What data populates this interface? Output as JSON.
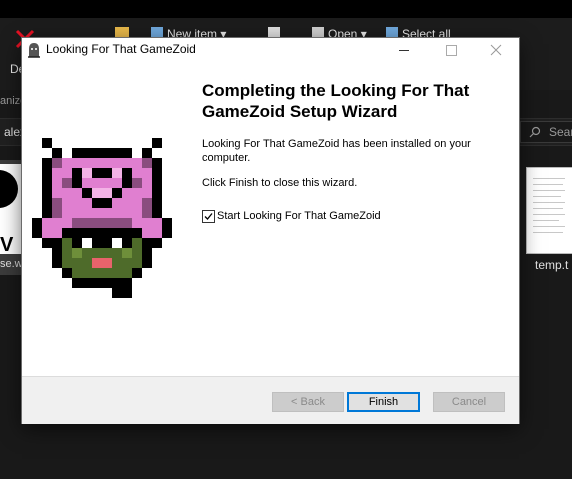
{
  "background": {
    "toolbar": {
      "delete_label": "De",
      "new_item_label": "New item",
      "open_label": "Open",
      "select_all_label": "Select all",
      "organize_label": "anize"
    },
    "address_bar": {
      "text": "alex"
    },
    "search": {
      "placeholder": "Searc"
    },
    "files": [
      {
        "name": "se.wa"
      },
      {
        "name": "temp.t"
      }
    ]
  },
  "dialog": {
    "title": "Looking For That GameZoid",
    "heading": "Completing the Looking For That GameZoid Setup Wizard",
    "installed_message": "Looking For That GameZoid has been installed on your computer.",
    "finish_instruction": "Click Finish to close this wizard.",
    "launch_checkbox": {
      "label": "Start Looking For That GameZoid",
      "checked": true
    },
    "buttons": {
      "back": "< Back",
      "finish": "Finish",
      "cancel": "Cancel"
    }
  },
  "colors": {
    "accent": "#0078d7",
    "creature_pink": "#e07fd0",
    "creature_green": "#4e6b2a",
    "creature_mouth": "#e8636b"
  }
}
